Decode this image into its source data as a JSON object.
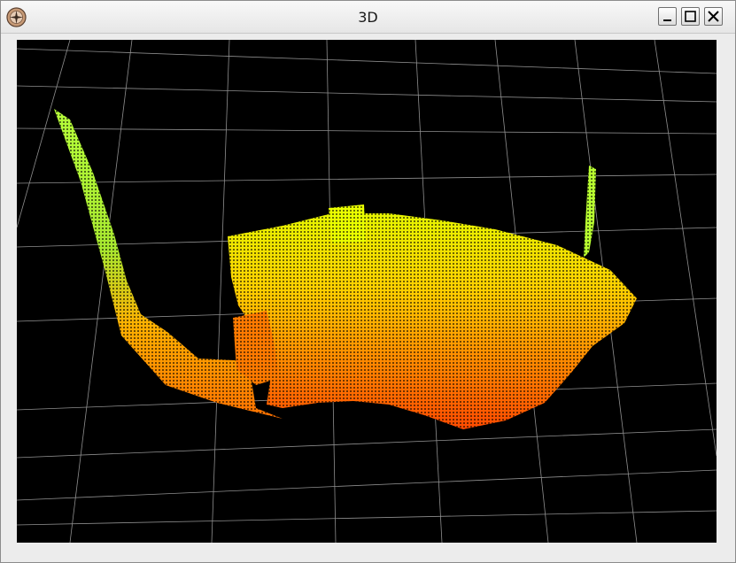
{
  "window": {
    "title": "3D",
    "icon": "compass-app-icon",
    "buttons": {
      "minimize": "minimize-icon",
      "maximize": "maximize-icon",
      "close": "close-icon"
    }
  },
  "viewport": {
    "background": "#000000",
    "grid_color": "#bfbfbf",
    "colors": {
      "near": "#ff5a00",
      "mid": "#ffa000",
      "far": "#f2f000",
      "edge": "#b8ff30"
    }
  }
}
